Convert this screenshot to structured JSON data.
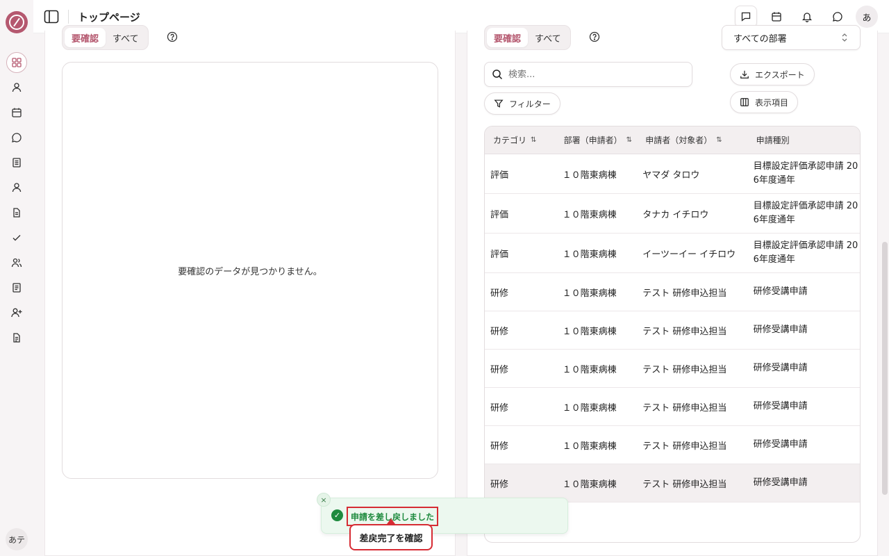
{
  "header": {
    "title": "トップページ",
    "avatar_text": "あ"
  },
  "sidebar": {
    "user_text": "あテ",
    "items": [
      {
        "icon": "dashboard-icon"
      },
      {
        "icon": "user-icon"
      },
      {
        "icon": "calendar-icon"
      },
      {
        "icon": "chat-icon"
      },
      {
        "icon": "document-icon"
      },
      {
        "icon": "person-icon"
      },
      {
        "icon": "file-icon"
      },
      {
        "icon": "check-icon"
      },
      {
        "icon": "users-icon"
      },
      {
        "icon": "list-icon"
      },
      {
        "icon": "user-plus-icon"
      },
      {
        "icon": "report-icon"
      }
    ]
  },
  "left_panel": {
    "tab_pending": "要確認",
    "tab_all": "すべて",
    "empty_message": "要確認のデータが見つかりません。"
  },
  "right_panel": {
    "tab_pending": "要確認",
    "tab_all": "すべて",
    "dept_select": "すべての部署",
    "search_placeholder": "検索...",
    "filter_label": "フィルター",
    "export_label": "エクスポート",
    "columns_label": "表示項目",
    "table": {
      "headers": [
        "カテゴリ",
        "部署（申請者）",
        "申請者（対象者）",
        "申請種別"
      ],
      "rows": [
        {
          "category": "評価",
          "dept": "１０階東病棟",
          "applicant": "ヤマダ タロウ",
          "type_line1": "目標設定評価承認申請 20",
          "type_line2": "6年度通年"
        },
        {
          "category": "評価",
          "dept": "１０階東病棟",
          "applicant": "タナカ イチロウ",
          "type_line1": "目標設定評価承認申請 20",
          "type_line2": "6年度通年"
        },
        {
          "category": "評価",
          "dept": "１０階東病棟",
          "applicant": "イーツーイー イチロウ",
          "type_line1": "目標設定評価承認申請 20",
          "type_line2": "6年度通年"
        },
        {
          "category": "研修",
          "dept": "１０階東病棟",
          "applicant": "テスト 研修申込担当",
          "type_line1": "研修受講申請",
          "type_line2": ""
        },
        {
          "category": "研修",
          "dept": "１０階東病棟",
          "applicant": "テスト 研修申込担当",
          "type_line1": "研修受講申請",
          "type_line2": ""
        },
        {
          "category": "研修",
          "dept": "１０階東病棟",
          "applicant": "テスト 研修申込担当",
          "type_line1": "研修受講申請",
          "type_line2": ""
        },
        {
          "category": "研修",
          "dept": "１０階東病棟",
          "applicant": "テスト 研修申込担当",
          "type_line1": "研修受講申請",
          "type_line2": ""
        },
        {
          "category": "研修",
          "dept": "１０階東病棟",
          "applicant": "テスト 研修申込担当",
          "type_line1": "研修受講申請",
          "type_line2": ""
        },
        {
          "category": "研修",
          "dept": "１０階東病棟",
          "applicant": "テスト 研修申込担当",
          "type_line1": "研修受講申請",
          "type_line2": ""
        }
      ]
    }
  },
  "toast": {
    "close_symbol": "×",
    "message": "申請を差し戻しました"
  },
  "tooltip": {
    "text": "差戻完了を確認"
  },
  "colors": {
    "brand": "#b5586f",
    "success": "#1e8a3e",
    "highlight": "#d62b33"
  }
}
